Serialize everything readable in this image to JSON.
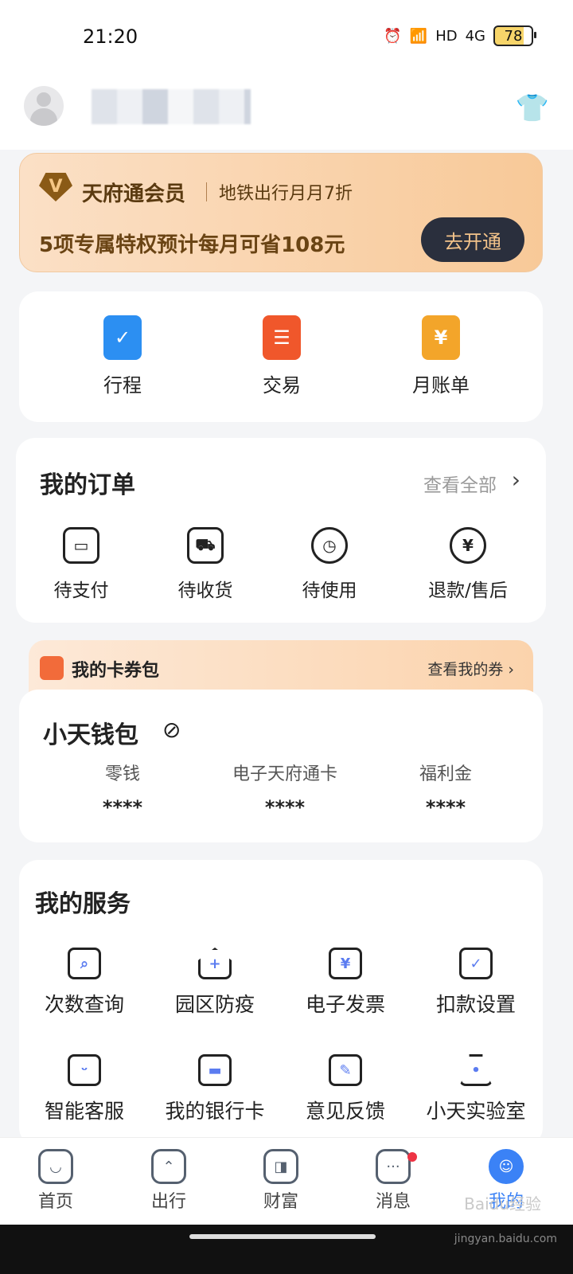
{
  "status": {
    "time": "21:20",
    "signal": "4G",
    "hd": "HD",
    "battery": "78"
  },
  "vip": {
    "title": "天府通会员",
    "subtitle": "地铁出行月月7折",
    "savings": "5项专属特权预计每月可省108元",
    "button": "去开通",
    "badge": "V"
  },
  "quick": [
    {
      "label": "行程",
      "icon": "itinerary-icon",
      "color": "#2c8ff2"
    },
    {
      "label": "交易",
      "icon": "transaction-icon",
      "color": "#f0572b"
    },
    {
      "label": "月账单",
      "icon": "monthly-bill-icon",
      "color": "#f3a52a"
    }
  ],
  "orders": {
    "title": "我的订单",
    "see_all": "查看全部",
    "items": [
      "待支付",
      "待收货",
      "待使用",
      "退款/售后"
    ]
  },
  "coupon": {
    "title": "我的卡券包",
    "link": "查看我的券 ›"
  },
  "wallet": {
    "title": "小天钱包",
    "cols": [
      {
        "label": "零钱",
        "value": "****"
      },
      {
        "label": "电子天府通卡",
        "value": "****"
      },
      {
        "label": "福利金",
        "value": "****"
      }
    ]
  },
  "services": {
    "title": "我的服务",
    "items": [
      "次数查询",
      "园区防疫",
      "电子发票",
      "扣款设置",
      "智能客服",
      "我的银行卡",
      "意见反馈",
      "小天实验室"
    ]
  },
  "tabs": [
    "首页",
    "出行",
    "财富",
    "消息",
    "我的"
  ],
  "watermark": "Baidu经验",
  "watermark_url": "jingyan.baidu.com"
}
